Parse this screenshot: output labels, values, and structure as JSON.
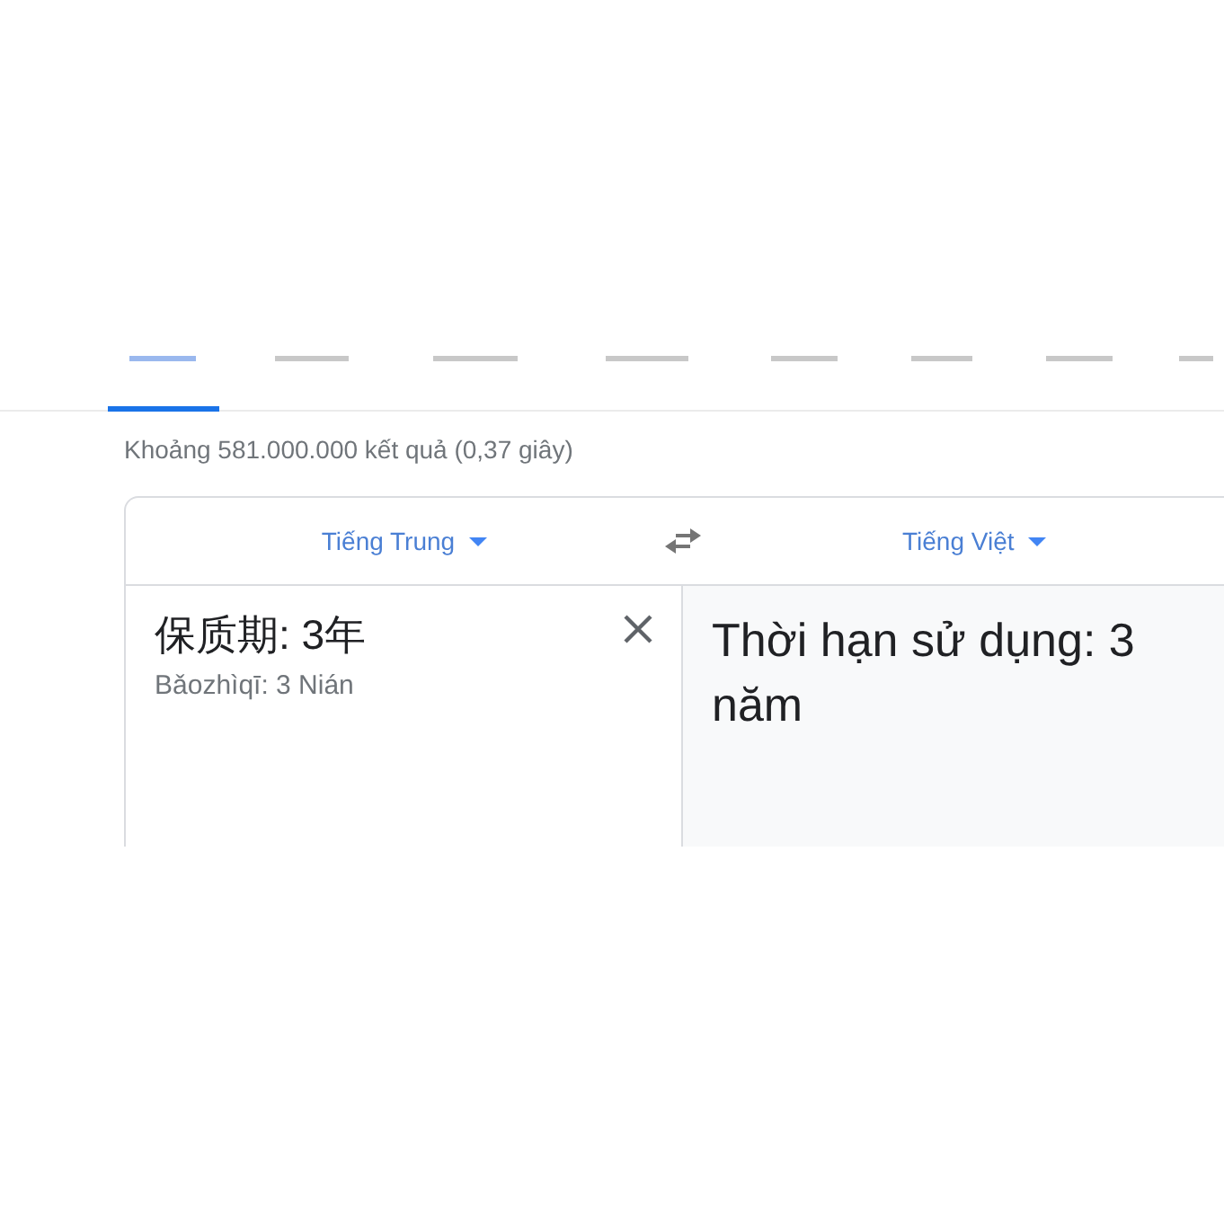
{
  "tabs": [
    {
      "selected": true
    },
    {
      "selected": false
    },
    {
      "selected": false
    },
    {
      "selected": false
    },
    {
      "selected": false
    },
    {
      "selected": false
    },
    {
      "selected": false
    },
    {
      "selected": false
    }
  ],
  "result_stats": "Khoảng 581.000.000 kết quả (0,37 giây)",
  "translator": {
    "source_language": "Tiếng Trung",
    "target_language": "Tiếng Việt",
    "source_text": "保质期: 3年",
    "romanization": "Bǎozhìqī: 3 Nián",
    "translation": "Thời hạn sử dụng: 3 năm"
  }
}
